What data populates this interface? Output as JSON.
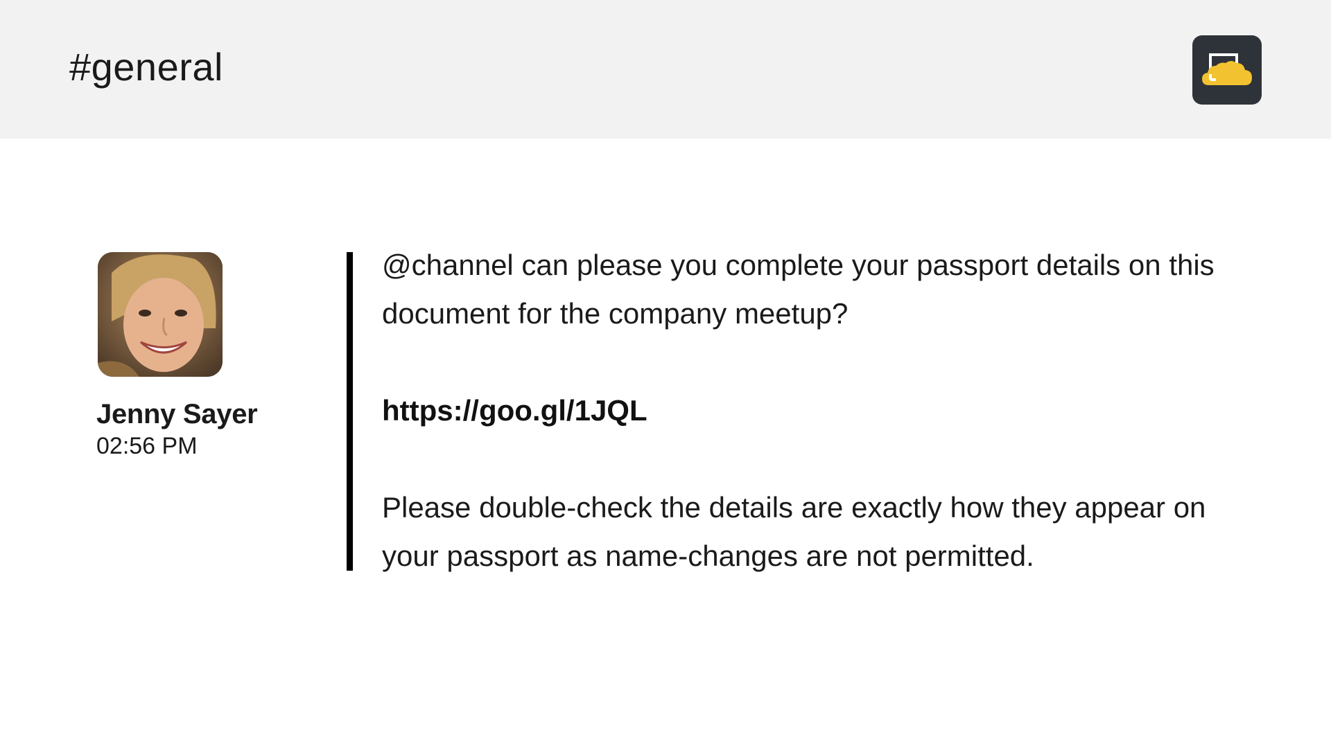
{
  "header": {
    "channel_title": "#general",
    "logo_icon": "cloud-screen-logo-icon",
    "logo_bg": "#2e3239",
    "logo_accent": "#f2c230"
  },
  "message": {
    "author": "Jenny Sayer",
    "time": "02:56 PM",
    "avatar_icon": "user-avatar-photo",
    "paragraph_1": "@channel can please you complete your passport details on this document for the company meetup?",
    "link": "https://goo.gl/1JQL",
    "paragraph_2": "Please double-check the details are exactly how they appear on your passport as name-changes are not permitted."
  },
  "colors": {
    "header_bg": "#f2f2f2",
    "page_bg": "#ffffff",
    "quote_bar": "#000000",
    "text": "#1a1a1a"
  }
}
